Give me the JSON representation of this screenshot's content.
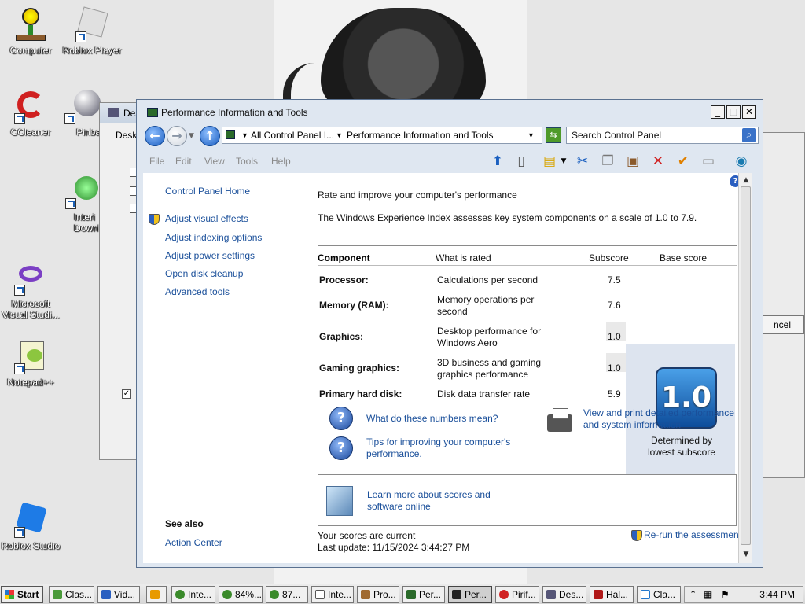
{
  "desktop": {
    "icons": [
      {
        "label": "Computer"
      },
      {
        "label": "Roblox Player"
      },
      {
        "label": "CCleaner"
      },
      {
        "label": "Pinba"
      },
      {
        "label": "Interi Downl"
      },
      {
        "label": "Microsoft Visual Studi..."
      },
      {
        "label": "Notepad++"
      },
      {
        "label": "Roblox Studio"
      }
    ]
  },
  "background_window": {
    "title": "Des",
    "tab": "Desk"
  },
  "right_window": {
    "cancel_label": "ncel"
  },
  "window": {
    "title": "Performance Information and Tools",
    "address": {
      "root": "All Control Panel I...",
      "current": "Performance Information and Tools"
    },
    "search_placeholder": "Search Control Panel",
    "menu": [
      "File",
      "Edit",
      "View",
      "Tools",
      "Help"
    ]
  },
  "left_pane": {
    "home": "Control Panel Home",
    "links": [
      "Adjust visual effects",
      "Adjust indexing options",
      "Adjust power settings",
      "Open disk cleanup",
      "Advanced tools"
    ],
    "see_also_heading": "See also",
    "see_also_links": [
      "Action Center"
    ]
  },
  "main": {
    "heading": "Rate and improve your computer's performance",
    "description": "The Windows Experience Index assesses key system components on a scale of 1.0 to 7.9.",
    "table": {
      "headers": {
        "component": "Component",
        "rated": "What is rated",
        "subscore": "Subscore",
        "base": "Base score"
      },
      "rows": [
        {
          "component": "Processor:",
          "rated": "Calculations per second",
          "subscore": "7.5"
        },
        {
          "component": "Memory (RAM):",
          "rated": "Memory operations per second",
          "subscore": "7.6"
        },
        {
          "component": "Graphics:",
          "rated": "Desktop performance for Windows Aero",
          "subscore": "1.0"
        },
        {
          "component": "Gaming graphics:",
          "rated": "3D business and gaming graphics performance",
          "subscore": "1.0"
        },
        {
          "component": "Primary hard disk:",
          "rated": "Disk data transfer rate",
          "subscore": "5.9"
        }
      ],
      "base_score": "1.0",
      "base_caption": "Determined by lowest subscore"
    },
    "links": {
      "numbers": "What do these numbers mean?",
      "tips": "Tips for improving your computer's performance.",
      "print": "View and print detailed performance and system information",
      "learn": "Learn more about scores and software online",
      "rerun": "Re-run the assessment"
    },
    "status": {
      "current": "Your scores are current",
      "last_update": "Last update: 11/15/2024 3:44:27 PM"
    }
  },
  "taskbar": {
    "start": "Start",
    "buttons": [
      "Clas...",
      "Vid...",
      "",
      "Inte...",
      "84%...",
      "87...",
      "Inte...",
      "Pro...",
      "Per...",
      "Per...",
      "Pirif...",
      "Des...",
      "Hal...",
      "Cla..."
    ],
    "clock": "3:44 PM",
    "colors": {
      "accent": "#1a4f9a"
    }
  }
}
